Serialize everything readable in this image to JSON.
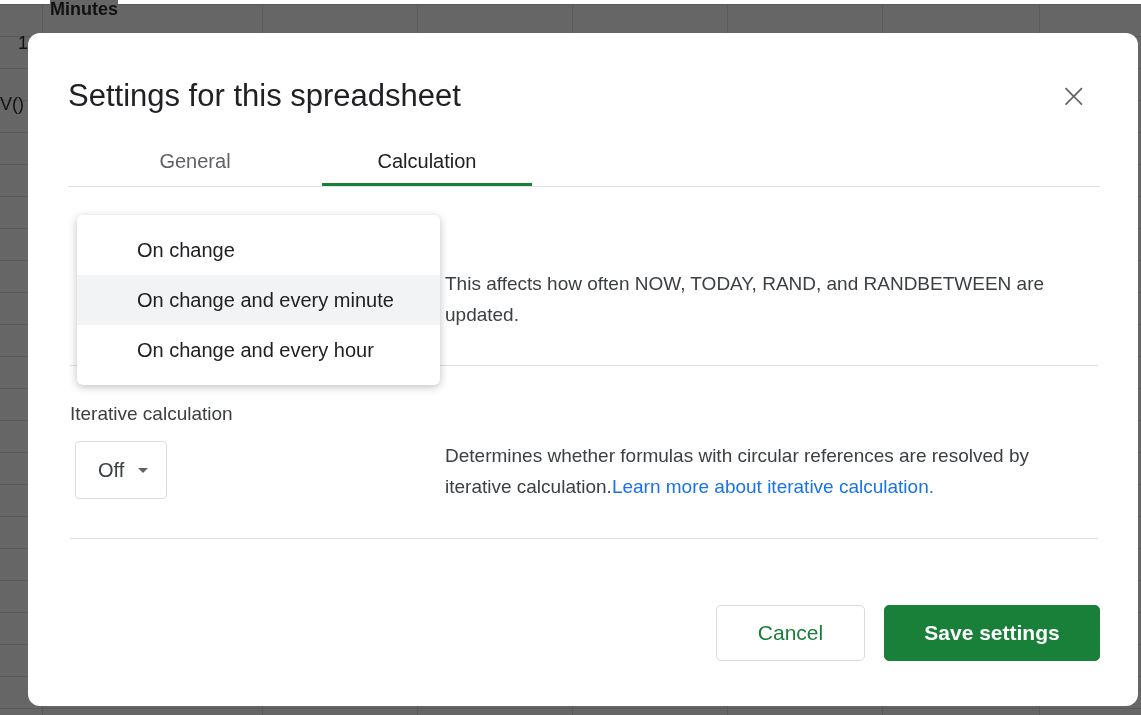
{
  "spreadsheet": {
    "header_cell": "Minutes",
    "row_number": "1",
    "formula_fragment": "V()"
  },
  "dialog": {
    "title": "Settings for this spreadsheet",
    "close": "×",
    "tabs": [
      {
        "label": "General",
        "selected": false
      },
      {
        "label": "Calculation",
        "selected": true
      }
    ],
    "sections": [
      {
        "description": "This affects how often NOW, TODAY, RAND, and RANDBETWEEN are updated.",
        "menu": [
          {
            "label": "On change",
            "selected": false
          },
          {
            "label": "On change and every minute",
            "selected": true
          },
          {
            "label": "On change and every hour",
            "selected": false
          }
        ]
      },
      {
        "label": "Iterative calculation",
        "value": "Off",
        "description": "Determines whether formulas with circular references are resolved by iterative calculation.",
        "link": "Learn more about iterative calculation."
      }
    ],
    "buttons": [
      {
        "label": "Cancel",
        "kind": "secondary"
      },
      {
        "label": "Save settings",
        "kind": "primary"
      }
    ]
  }
}
